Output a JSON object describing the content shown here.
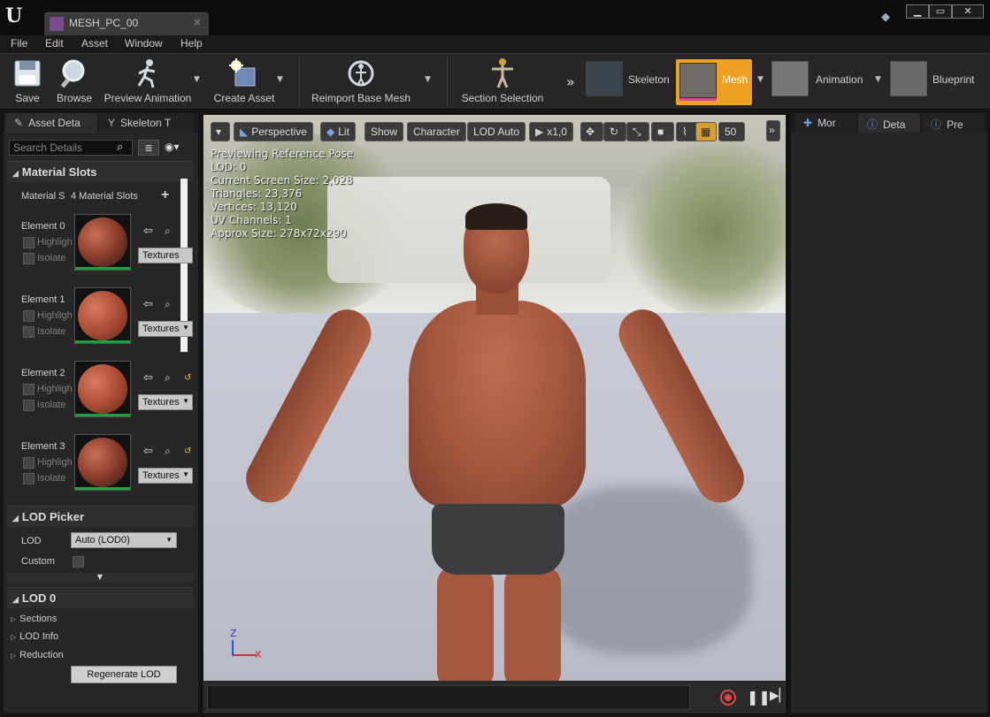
{
  "window": {
    "tab_title": "MESH_PC_00",
    "tab_close": "×",
    "minimize": "▁",
    "maximize": "▭",
    "close": "✕"
  },
  "menu": [
    "File",
    "Edit",
    "Asset",
    "Window",
    "Help"
  ],
  "toolbar": {
    "save": "Save",
    "browse": "Browse",
    "preview_animation": "Preview Animation",
    "create_asset": "Create Asset",
    "reimport": "Reimport Base Mesh",
    "section_selection": "Section Selection",
    "modes": {
      "skeleton": "Skeleton",
      "mesh": "Mesh",
      "animation": "Animation",
      "blueprint": "Blueprint"
    },
    "active_mode_color": "#f0a020"
  },
  "left_panel": {
    "tabs": [
      "Asset Deta",
      "Skeleton T"
    ],
    "search_placeholder": "Search Details",
    "material_slots": {
      "header": "Material Slots",
      "row_label": "Material S",
      "count": "4 Material Slots",
      "add": "+",
      "elements": [
        {
          "label": "Element 0",
          "highlight": "Highligh",
          "isolate": "Isolate",
          "textures": "Textures"
        },
        {
          "label": "Element 1",
          "highlight": "Highligh",
          "isolate": "Isolate",
          "textures": "Textures"
        },
        {
          "label": "Element 2",
          "highlight": "Highligh",
          "isolate": "Isolate",
          "textures": "Textures"
        },
        {
          "label": "Element 3",
          "highlight": "Highligh",
          "isolate": "Isolate",
          "textures": "Textures"
        }
      ]
    },
    "lod_picker": {
      "header": "LOD Picker",
      "lod_label": "LOD",
      "lod_value": "Auto (LOD0)",
      "custom_label": "Custom"
    },
    "lod0": {
      "header": "LOD 0",
      "sections": "Sections",
      "lod_info": "LOD Info",
      "reduction": "Reduction",
      "regenerate": "Regenerate LOD"
    }
  },
  "viewport": {
    "perspective": "Perspective",
    "lit": "Lit",
    "show": "Show",
    "character": "Character",
    "lod_auto": "LOD Auto",
    "speed": "x1,0",
    "grid_value": "50",
    "stats": [
      "Previewing Reference Pose",
      "LOD: 0",
      "Current Screen Size: 2,028",
      "Triangles: 23,376",
      "Vertices: 13,120",
      "UV Channels: 1",
      "Approx Size: 278x72x290"
    ],
    "axis_z": "Z",
    "axis_x": "X"
  },
  "right_panel": {
    "tabs": [
      "Mor",
      "Deta",
      "Pre"
    ]
  }
}
